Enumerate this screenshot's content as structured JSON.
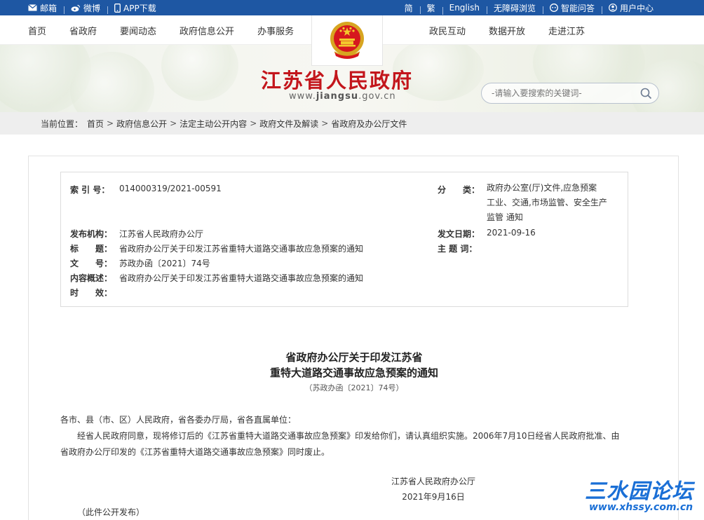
{
  "topbar": {
    "left": [
      {
        "icon": "mail-icon",
        "label": "邮箱"
      },
      {
        "icon": "weibo-icon",
        "label": "微博"
      },
      {
        "icon": "phone-icon",
        "label": "APP下载"
      }
    ],
    "right": [
      {
        "label": "简"
      },
      {
        "label": "繁"
      },
      {
        "label": "English"
      },
      {
        "label": "无障碍浏览"
      },
      {
        "icon": "robot-icon",
        "label": "智能问答"
      },
      {
        "icon": "user-icon",
        "label": "用户中心"
      }
    ]
  },
  "nav": {
    "left": [
      "首页",
      "省政府",
      "要闻动态",
      "政府信息公开",
      "办事服务"
    ],
    "right": [
      "政民互动",
      "数据开放",
      "走进江苏"
    ]
  },
  "banner": {
    "site_title": "江苏省人民政府",
    "url_prefix": "www.",
    "url_domain": "jiangsu",
    "url_suffix": ".gov.cn",
    "search_placeholder": "-请输入要搜索的关键词-"
  },
  "breadcrumb": {
    "label": "当前位置：",
    "items": [
      "首页",
      "政府信息公开",
      "法定主动公开内容",
      "政府文件及解读",
      "省政府及办公厅文件"
    ]
  },
  "meta": {
    "index_label": "索 引 号：",
    "index_value": "014000319/2021-00591",
    "category_label": "分　　类：",
    "category_value": "政府办公室(厅)文件,应急预案 工业、交通,市场监管、安全生产监管 通知",
    "issuer_label": "发布机构：",
    "issuer_value": "江苏省人民政府办公厅",
    "date_label": "发文日期：",
    "date_value": "2021-09-16",
    "title_label": "标　　题：",
    "title_value": "省政府办公厅关于印发江苏省重特大道路交通事故应急预案的通知",
    "subject_label": "主 题 词：",
    "subject_value": "",
    "docno_label": "文　　号：",
    "docno_value": "苏政办函〔2021〕74号",
    "summary_label": "内容概述：",
    "summary_value": "省政府办公厅关于印发江苏省重特大道路交通事故应急预案的通知",
    "validity_label": "时　　效：",
    "validity_value": ""
  },
  "document": {
    "title_line1": "省政府办公厅关于印发江苏省",
    "title_line2": "重特大道路交通事故应急预案的通知",
    "number": "（苏政办函〔2021〕74号）",
    "salutation": "各市、县（市、区）人民政府，省各委办厅局，省各直属单位：",
    "para1_line1": "经省人民政府同意，现将修订后的《江苏省重特大道路交通事故应急预案》印发给你们，请认真组织实施。2006年7月10日经省人民政府批准、由",
    "para1_line2": "省政府办公厅印发的《江苏省重特大道路交通事故应急预案》同时废止。",
    "signer": "江苏省人民政府办公厅",
    "sign_date": "2021年9月16日",
    "footnote": "（此件公开发布）"
  },
  "watermark": {
    "name": "三水园论坛",
    "url": "www.xhssy.com.cn"
  },
  "colors": {
    "topbar": "#1e57a3",
    "title_red": "#c3161c",
    "watermark_blue": "#1a6fd6"
  }
}
